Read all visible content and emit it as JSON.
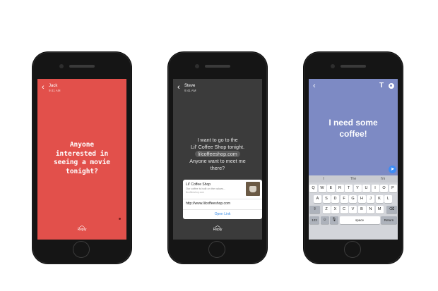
{
  "phones": [
    {
      "contact": "Jack",
      "time": "9:41 AM",
      "message_lines": [
        "Anyone",
        "interested in",
        "seeing a movie",
        "tonight?"
      ],
      "reply_label": "Reply",
      "bg": "#e2504b"
    },
    {
      "contact": "Steve",
      "time": "9:41 AM",
      "message_lines": [
        "I want to go to the",
        "Lil' Coffee Shop tonight.",
        "lilcoffeeshop.com",
        "Anyone want to meet me",
        "there?"
      ],
      "link_card": {
        "title": "Lil' Coffee Shop",
        "description": "Our coffee is built on the values...",
        "domain": "lilcoffeeshop.com",
        "url": "http://www.lilcoffeeshop.com",
        "action": "Open Link"
      },
      "reply_label": "Reply",
      "bg": "#3b3b3b"
    },
    {
      "compose_lines": [
        "I need some",
        "coffee!"
      ],
      "text_tool": "T",
      "suggestions": [
        "I",
        "The",
        "I'm"
      ],
      "keys": {
        "row1": [
          "Q",
          "W",
          "E",
          "R",
          "T",
          "Y",
          "U",
          "I",
          "O",
          "P"
        ],
        "row2": [
          "A",
          "S",
          "D",
          "F",
          "G",
          "H",
          "J",
          "K",
          "L"
        ],
        "row3": [
          "Z",
          "X",
          "C",
          "V",
          "B",
          "N",
          "M"
        ],
        "numbers": "123",
        "space": "space",
        "return": "Return"
      },
      "bg": "#7d8ac4",
      "accent": "#3d8cf4"
    }
  ]
}
